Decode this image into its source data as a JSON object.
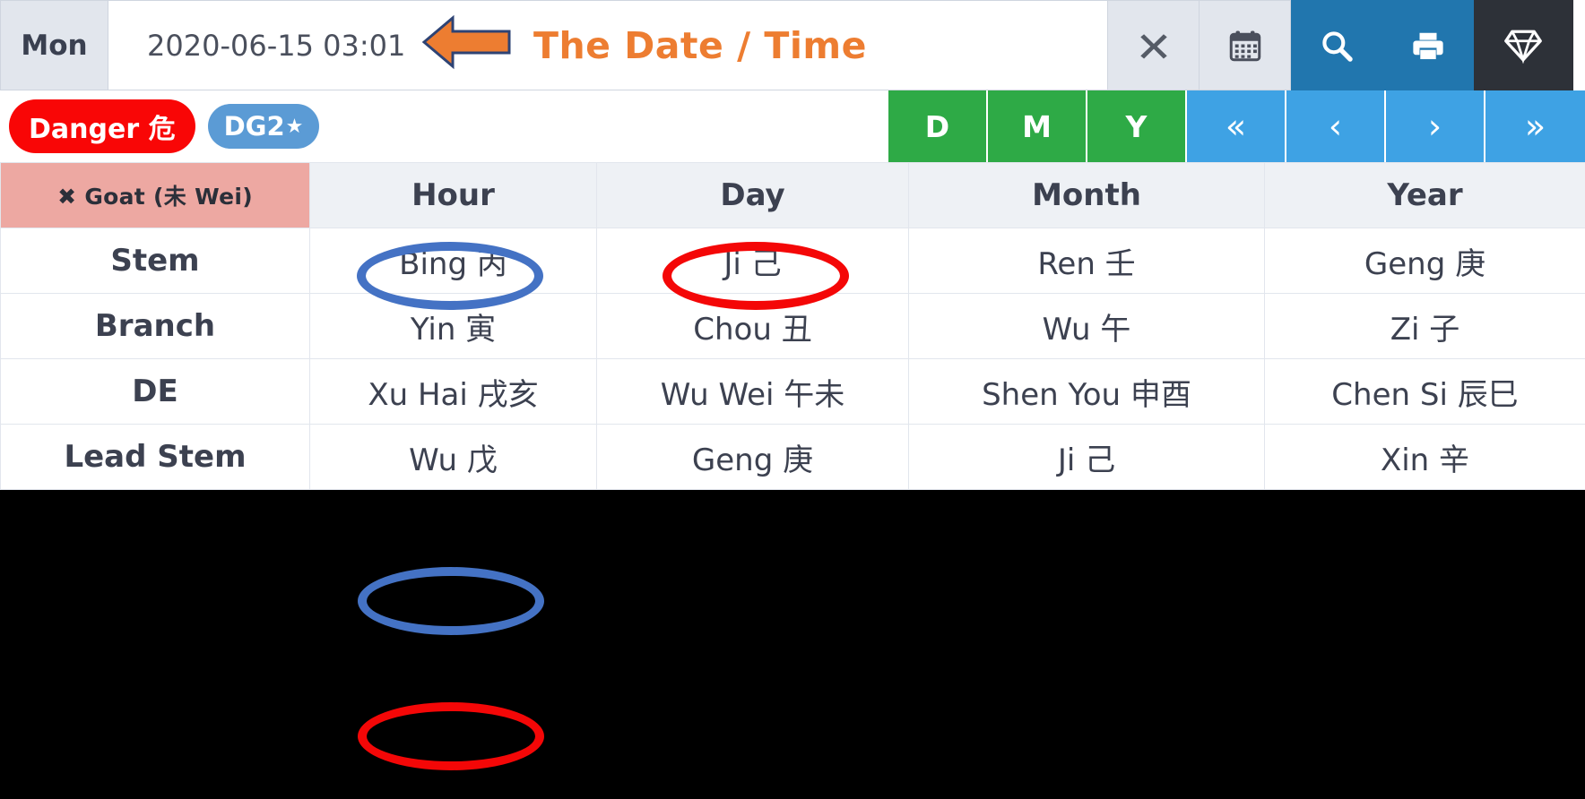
{
  "date_bar": {
    "weekday_label": "Mon",
    "datetime_value": "2020-06-15 03:01",
    "datetime_placeholder": "YYYY-MM-DD HH:mm",
    "clear_icon": "close-x-icon",
    "calendar_icon": "calendar-icon",
    "search_icon": "search-icon",
    "print_icon": "print-icon",
    "gem_icon": "diamond-gem-icon"
  },
  "annotation": {
    "arrow_icon": "left-arrow-icon",
    "text": "The Date / Time",
    "color": "#ED7D31"
  },
  "badges": [
    {
      "label": "Danger 危",
      "color": "#f90606",
      "name": "danger-badge"
    },
    {
      "label": "DG2",
      "star": "★",
      "color": "#5b9bd5",
      "name": "dg2-badge"
    }
  ],
  "nav": {
    "period_buttons": [
      {
        "label": "D",
        "name": "day-button"
      },
      {
        "label": "M",
        "name": "month-button"
      },
      {
        "label": "Y",
        "name": "year-button"
      }
    ],
    "period_color": "#2eaa46",
    "step_buttons": [
      {
        "label": "«",
        "name": "first-button"
      },
      {
        "label": "‹",
        "name": "prev-button"
      },
      {
        "label": "›",
        "name": "next-button"
      },
      {
        "label": "»",
        "name": "last-button"
      }
    ],
    "step_color": "#3ea2e4"
  },
  "table": {
    "animal_header": "✖ Goat (未 Wei)",
    "columns": [
      "Hour",
      "Day",
      "Month",
      "Year"
    ],
    "rows": [
      {
        "label": "Stem",
        "values": [
          "Bing 丙",
          "Ji 己",
          "Ren 壬",
          "Geng 庚"
        ]
      },
      {
        "label": "Branch",
        "values": [
          "Yin 寅",
          "Chou 丑",
          "Wu 午",
          "Zi 子"
        ]
      },
      {
        "label": "DE",
        "values": [
          "Xu Hai 戌亥",
          "Wu Wei 午未",
          "Shen You 申酉",
          "Chen Si 辰巳"
        ]
      },
      {
        "label": "Lead Stem",
        "values": [
          "Wu 戊",
          "Geng 庚",
          "Ji 己",
          "Xin 辛"
        ]
      }
    ]
  },
  "highlights": [
    {
      "name": "hour-stem-highlight",
      "color": "#4472c4",
      "target": "Bing 丙"
    },
    {
      "name": "day-stem-highlight",
      "color": "#f40707",
      "target": "Ji 己"
    },
    {
      "name": "lower-blue-highlight",
      "color": "#4472c4",
      "target": ""
    },
    {
      "name": "lower-red-highlight",
      "color": "#f40707",
      "target": ""
    }
  ]
}
